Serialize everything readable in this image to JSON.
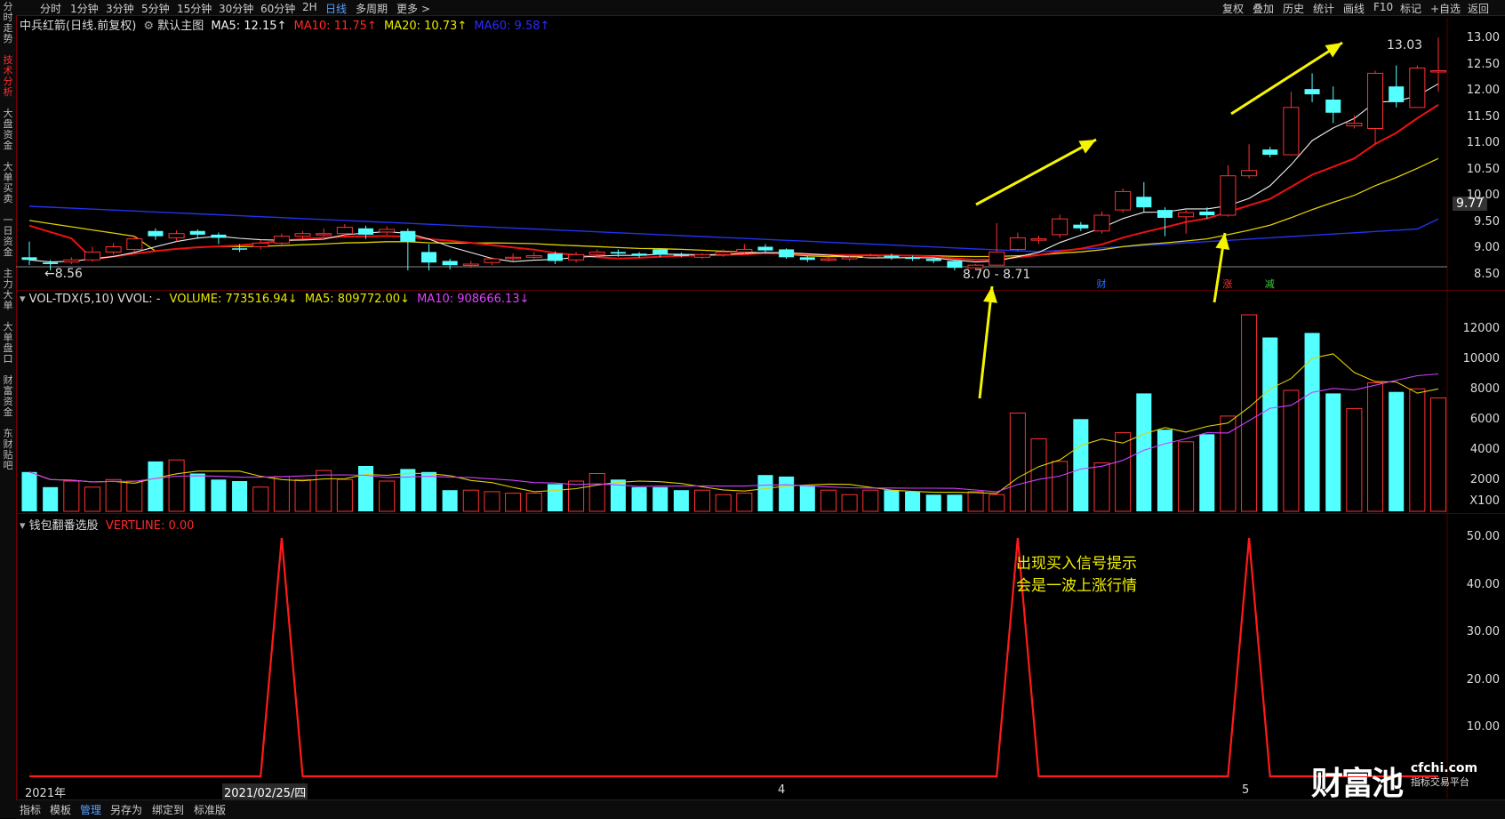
{
  "left_tabs": [
    {
      "label": "分时走势",
      "active": false
    },
    {
      "label": "技术分析",
      "active": true
    },
    {
      "label": "大盘资金",
      "active": false
    },
    {
      "label": "大单买卖",
      "active": false
    },
    {
      "label": "一日资金",
      "active": false
    },
    {
      "label": "主力大单",
      "active": false
    },
    {
      "label": "大单盘口",
      "active": false
    },
    {
      "label": "财富资金",
      "active": false
    },
    {
      "label": "东财贴吧",
      "active": false
    }
  ],
  "period_tabs": [
    "分时",
    "1分钟",
    "3分钟",
    "5分钟",
    "15分钟",
    "30分钟",
    "60分钟",
    "2H",
    "日线",
    "多周期",
    "更多 >"
  ],
  "active_period": "日线",
  "right_tools": [
    "复权",
    "叠加",
    "历史",
    "统计",
    "画线",
    "F10",
    "标记",
    "+自选",
    "返回"
  ],
  "main_panel": {
    "stock": "中兵红箭(日线.前复权)",
    "indicator": "默认主图",
    "ma5": "MA5: 12.15↑",
    "ma10": "MA10: 11.75↑",
    "ma20": "MA20: 10.73↑",
    "ma60": "MA60: 9.58↑",
    "high_label": "13.03",
    "low_label": "←8.56",
    "range_label": "8.70 - 8.71",
    "current_price": "9.77",
    "event_badges": [
      "财",
      "涨",
      "减"
    ],
    "y_ticks": [
      "13.00",
      "12.50",
      "12.00",
      "11.50",
      "11.00",
      "10.50",
      "10.00",
      "9.50",
      "9.00",
      "8.50"
    ]
  },
  "volume_panel": {
    "title": "VOL-TDX(5,10) VVOL: -",
    "volume": "VOLUME: 773516.94↓",
    "ma5": "MA5: 809772.00↓",
    "ma10": "MA10: 908666.13↓",
    "y_ticks": [
      "12000",
      "10000",
      "8000",
      "6000",
      "4000",
      "2000"
    ],
    "unit": "X100"
  },
  "signal_panel": {
    "title": "钱包翻番选股",
    "value": "VERTLINE: 0.00",
    "annotation_line1": "出现买入信号提示",
    "annotation_line2": "会是一波上涨行情",
    "y_ticks": [
      "50.00",
      "40.00",
      "30.00",
      "20.00",
      "10.00"
    ]
  },
  "x_axis": [
    "2021年",
    "2021/02/25/四",
    "4",
    "5"
  ],
  "bottom_tabs": [
    "指标",
    "模板",
    "管理",
    "另存为",
    "绑定到",
    "标准版"
  ],
  "active_bottom": "管理",
  "watermark": {
    "brand": "财富池",
    "site": "cfchi.com",
    "slogan": "指标交易平台"
  },
  "chart_data": [
    {
      "type": "candlestick",
      "title": "中兵红箭(日线.前复权)",
      "ylim": [
        8.5,
        13.05
      ],
      "ohlc": [
        [
          8.85,
          8.8,
          9.15,
          8.7
        ],
        [
          8.75,
          8.72,
          8.8,
          8.6
        ],
        [
          8.76,
          8.8,
          8.85,
          8.72
        ],
        [
          8.8,
          8.95,
          9.05,
          8.76
        ],
        [
          8.95,
          9.05,
          9.12,
          8.9
        ],
        [
          9.0,
          9.2,
          9.25,
          8.96
        ],
        [
          9.35,
          9.25,
          9.4,
          9.18
        ],
        [
          9.22,
          9.3,
          9.36,
          9.15
        ],
        [
          9.35,
          9.28,
          9.38,
          9.2
        ],
        [
          9.28,
          9.22,
          9.32,
          9.1
        ],
        [
          9.02,
          9.0,
          9.1,
          8.95
        ],
        [
          9.05,
          9.12,
          9.18,
          9.0
        ],
        [
          9.12,
          9.25,
          9.3,
          9.05
        ],
        [
          9.25,
          9.3,
          9.35,
          9.2
        ],
        [
          9.3,
          9.3,
          9.4,
          9.25
        ],
        [
          9.3,
          9.42,
          9.48,
          9.25
        ],
        [
          9.4,
          9.28,
          9.45,
          9.2
        ],
        [
          9.33,
          9.38,
          9.44,
          9.28
        ],
        [
          9.35,
          9.15,
          9.4,
          8.6
        ],
        [
          8.95,
          8.75,
          9.1,
          8.6
        ],
        [
          8.78,
          8.7,
          8.82,
          8.62
        ],
        [
          8.7,
          8.72,
          8.78,
          8.65
        ],
        [
          8.75,
          8.82,
          8.85,
          8.7
        ],
        [
          8.85,
          8.85,
          8.92,
          8.78
        ],
        [
          8.85,
          8.88,
          8.95,
          8.82
        ],
        [
          8.92,
          8.78,
          8.96,
          8.72
        ],
        [
          8.8,
          8.9,
          8.95,
          8.75
        ],
        [
          8.9,
          8.95,
          9.0,
          8.85
        ],
        [
          8.95,
          8.92,
          9.0,
          8.86
        ],
        [
          8.92,
          8.88,
          8.95,
          8.84
        ],
        [
          9.0,
          8.9,
          9.02,
          8.85
        ],
        [
          8.9,
          8.88,
          8.94,
          8.85
        ],
        [
          8.85,
          8.9,
          8.93,
          8.82
        ],
        [
          8.9,
          8.95,
          9.0,
          8.86
        ],
        [
          8.95,
          9.0,
          9.1,
          8.92
        ],
        [
          9.05,
          8.98,
          9.1,
          8.95
        ],
        [
          9.0,
          8.85,
          9.02,
          8.82
        ],
        [
          8.85,
          8.8,
          8.88,
          8.76
        ],
        [
          8.8,
          8.82,
          8.86,
          8.76
        ],
        [
          8.82,
          8.85,
          8.9,
          8.78
        ],
        [
          8.85,
          8.88,
          8.92,
          8.82
        ],
        [
          8.88,
          8.85,
          8.92,
          8.8
        ],
        [
          8.85,
          8.82,
          8.88,
          8.78
        ],
        [
          8.82,
          8.78,
          8.85,
          8.74
        ],
        [
          8.78,
          8.65,
          8.8,
          8.6
        ],
        [
          8.65,
          8.7,
          8.72,
          8.6
        ],
        [
          8.7,
          8.95,
          9.5,
          8.7
        ],
        [
          9.0,
          9.22,
          9.32,
          8.96
        ],
        [
          9.18,
          9.2,
          9.26,
          9.1
        ],
        [
          9.28,
          9.58,
          9.66,
          9.22
        ],
        [
          9.47,
          9.4,
          9.52,
          9.35
        ],
        [
          9.35,
          9.65,
          9.72,
          9.3
        ],
        [
          9.75,
          10.1,
          10.16,
          9.7
        ],
        [
          10.0,
          9.8,
          10.28,
          9.7
        ],
        [
          9.75,
          9.6,
          9.8,
          9.25
        ],
        [
          9.62,
          9.7,
          9.75,
          9.3
        ],
        [
          9.72,
          9.65,
          9.8,
          9.58
        ],
        [
          9.65,
          10.4,
          10.6,
          9.62
        ],
        [
          10.4,
          10.5,
          11.0,
          10.35
        ],
        [
          10.9,
          10.8,
          10.95,
          10.75
        ],
        [
          10.8,
          11.7,
          12.0,
          10.8
        ],
        [
          12.05,
          11.95,
          12.35,
          11.8
        ],
        [
          11.85,
          11.6,
          12.1,
          11.4
        ],
        [
          11.35,
          11.4,
          11.55,
          11.3
        ],
        [
          11.3,
          12.35,
          12.4,
          11.0
        ],
        [
          12.1,
          11.8,
          12.5,
          11.7
        ],
        [
          11.7,
          12.45,
          12.5,
          11.7
        ],
        [
          12.38,
          12.4,
          13.03,
          12.0
        ]
      ],
      "ma5_end": 12.15,
      "ma10_end": 11.75,
      "ma20_end": 10.73,
      "ma60_end": 9.58
    },
    {
      "type": "bar",
      "title": "VOL-TDX(5,10)",
      "ylim": [
        0,
        13000
      ],
      "values": [
        2600,
        1600,
        2000,
        1600,
        2100,
        2000,
        3300,
        3400,
        2500,
        2100,
        2000,
        1600,
        2300,
        2100,
        2700,
        2100,
        3000,
        2000,
        2800,
        2600,
        1400,
        1400,
        1300,
        1200,
        1200,
        1800,
        2000,
        2500,
        2100,
        1600,
        1600,
        1400,
        1400,
        1100,
        1200,
        2400,
        2300,
        1700,
        1400,
        1100,
        1400,
        1400,
        1300,
        1100,
        1100,
        1300,
        1100,
        6500,
        4800,
        3300,
        6100,
        3200,
        5200,
        7800,
        5400,
        4600,
        5100,
        6300,
        13000,
        11500,
        8000,
        11800,
        7800,
        6800,
        8500,
        7900,
        8100,
        7500
      ],
      "ma5_end": 8098,
      "ma10_end": 9087,
      "unit": "X100"
    },
    {
      "type": "line",
      "title": "钱包翻番选股",
      "ylim": [
        0,
        50
      ],
      "values": [
        0,
        0,
        0,
        0,
        0,
        0,
        0,
        0,
        0,
        0,
        0,
        0,
        50,
        0,
        0,
        0,
        0,
        0,
        0,
        0,
        0,
        0,
        0,
        0,
        0,
        0,
        0,
        0,
        0,
        0,
        0,
        0,
        0,
        0,
        0,
        0,
        0,
        0,
        0,
        0,
        0,
        0,
        0,
        0,
        0,
        0,
        0,
        50,
        0,
        0,
        0,
        0,
        0,
        0,
        0,
        0,
        0,
        0,
        50,
        0,
        0,
        0,
        0,
        0,
        0,
        0,
        0,
        0
      ]
    }
  ]
}
